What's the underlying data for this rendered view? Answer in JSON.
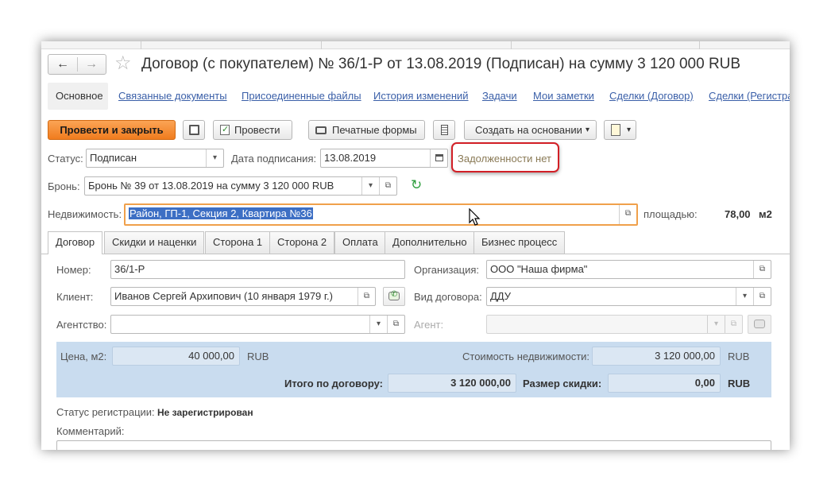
{
  "window": {
    "title": "Договор (с покупателем) № 36/1-Р от 13.08.2019 (Подписан) на сумму 3 120 000 RUB",
    "back_icon": "←",
    "forward_icon": "→",
    "star_icon": "☆"
  },
  "nav_tabs": {
    "active": "Основное",
    "links": [
      "Связанные документы",
      "Присоединенные файлы",
      "История изменений",
      "Задачи",
      "Мои заметки",
      "Сделки (Договор)",
      "Сделки (Регистра"
    ]
  },
  "toolbar": {
    "post_close": "Провести и закрыть",
    "save_icon": "💾",
    "post": "Провести",
    "print_forms": "Печатные формы",
    "create_based": "Создать на основании",
    "dropdown_icon": "▾"
  },
  "header": {
    "status_label": "Статус:",
    "status_value": "Подписан",
    "sign_date_label": "Дата подписания:",
    "sign_date_value": "13.08.2019",
    "debt_text": "Задолженности нет",
    "booking_label": "Бронь:",
    "booking_value": "Бронь № 39 от 13.08.2019 на сумму 3 120 000 RUB",
    "property_label": "Недвижимость:",
    "property_value": "Район, ГП-1, Секция 2, Квартира №36",
    "area_label": "площадью:",
    "area_value": "78,00",
    "area_unit": "м2"
  },
  "sub_tabs": [
    "Договор",
    "Скидки и наценки",
    "Сторона 1",
    "Сторона 2",
    "Оплата",
    "Дополнительно",
    "Бизнес процесс"
  ],
  "contract": {
    "number_label": "Номер:",
    "number_value": "36/1-Р",
    "org_label": "Организация:",
    "org_value": "ООО \"Наша фирма\"",
    "client_label": "Клиент:",
    "client_value": "Иванов Сергей Архипович (10 января 1979 г.)",
    "type_label": "Вид договора:",
    "type_value": "ДДУ",
    "agency_label": "Агентство:",
    "agency_value": "",
    "agent_label": "Агент:",
    "agent_value": ""
  },
  "price": {
    "price_label": "Цена, м2:",
    "price_value": "40 000,00",
    "currency": "RUB",
    "cost_label": "Стоимость недвижимости:",
    "cost_value": "3 120 000,00",
    "total_label": "Итого по договору:",
    "total_value": "3 120 000,00",
    "discount_label": "Размер скидки:",
    "discount_value": "0,00"
  },
  "footer": {
    "reg_status_label": "Статус регистрации:",
    "reg_status_value": "Не зарегистрирован",
    "comment_label": "Комментарий:"
  }
}
